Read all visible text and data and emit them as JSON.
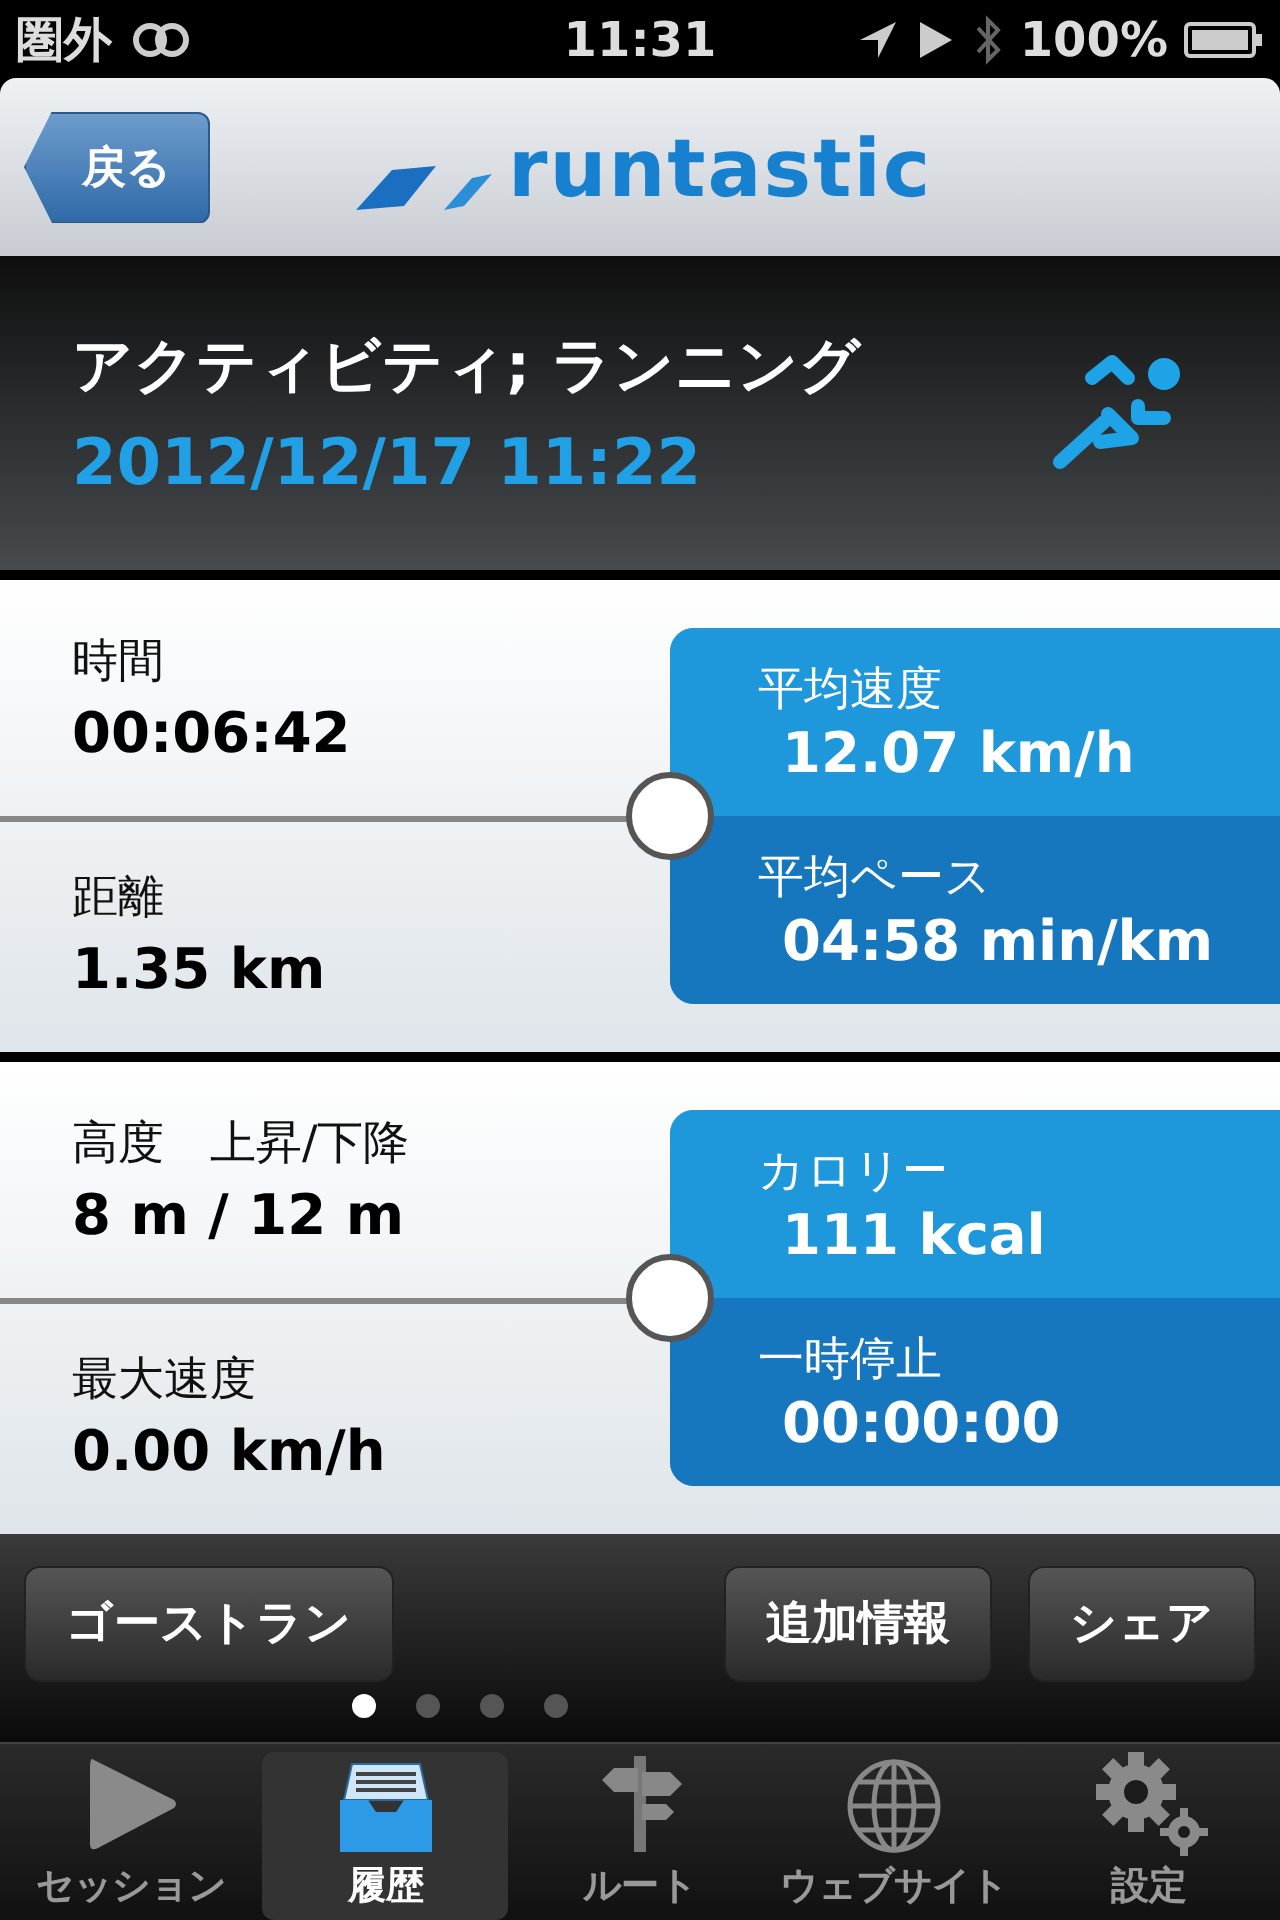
{
  "status_bar": {
    "carrier": "圏外",
    "time": "11:31",
    "battery": "100%"
  },
  "nav": {
    "back": "戻る",
    "logo": "runtastic"
  },
  "header": {
    "title": "アクティビティ; ランニング",
    "date": "2012/12/17 11:22"
  },
  "cards": [
    {
      "left": [
        {
          "label": "時間",
          "value": "00:06:42"
        },
        {
          "label": "距離",
          "value": "1.35 km"
        }
      ],
      "right": [
        {
          "label": "平均速度",
          "value": "12.07 km/h"
        },
        {
          "label": "平均ペース",
          "value": "04:58 min/km"
        }
      ]
    },
    {
      "left": [
        {
          "label": "高度　上昇/下降",
          "value": "8 m / 12 m"
        },
        {
          "label": "最大速度",
          "value": "0.00 km/h"
        }
      ],
      "right": [
        {
          "label": "カロリー",
          "value": "111 kcal"
        },
        {
          "label": "一時停止",
          "value": "00:00:00"
        }
      ]
    }
  ],
  "actions": {
    "left": [
      {
        "label": "ゴーストラン"
      }
    ],
    "right": [
      {
        "label": "追加情報"
      },
      {
        "label": "シェア"
      }
    ]
  },
  "pages": [
    {
      "selected": true
    },
    {
      "selected": false
    },
    {
      "selected": false
    },
    {
      "selected": false
    }
  ],
  "tabs": [
    {
      "label": "セッション",
      "kind": "play",
      "selected": false
    },
    {
      "label": "履歴",
      "kind": "history",
      "selected": true
    },
    {
      "label": "ルート",
      "kind": "route",
      "selected": false
    },
    {
      "label": "ウェブサイト",
      "kind": "web",
      "selected": false
    },
    {
      "label": "設定",
      "kind": "settings",
      "selected": false
    }
  ]
}
